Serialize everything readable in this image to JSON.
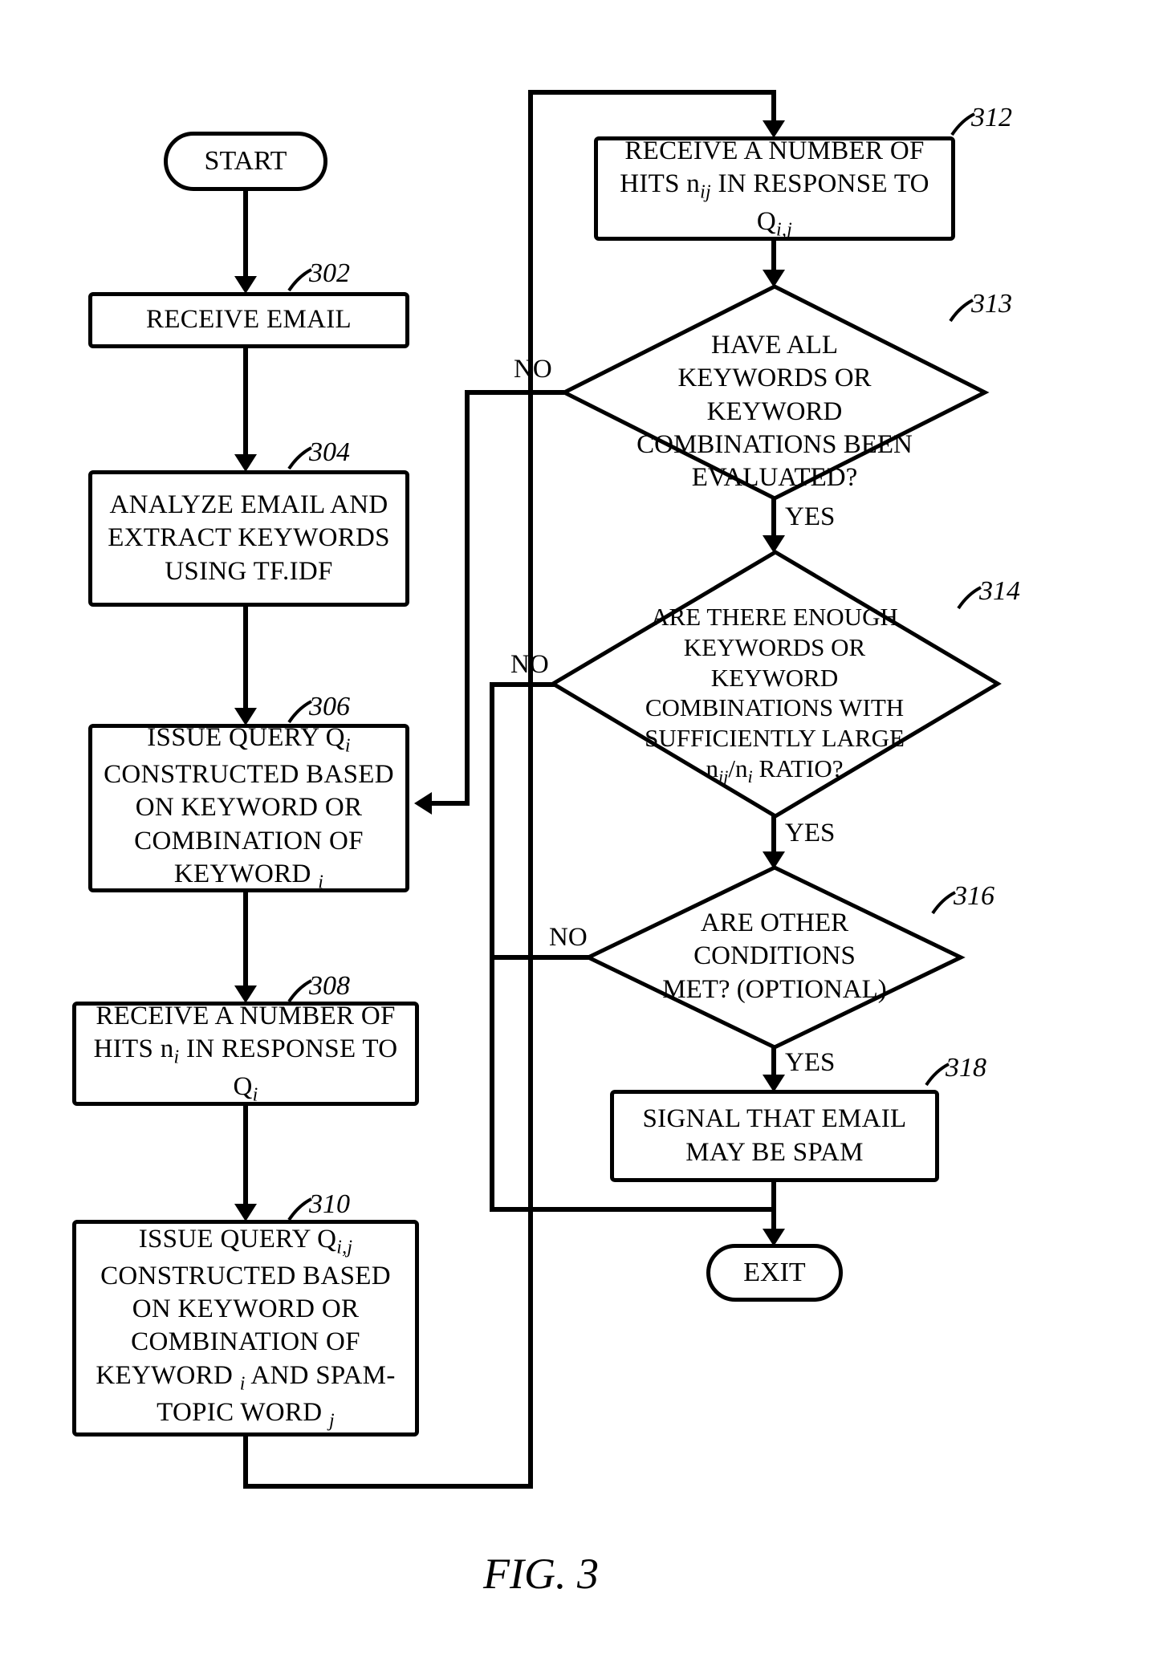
{
  "figure": "FIG. 3",
  "labels": {
    "start": "START",
    "exit": "EXIT",
    "yes": "YES",
    "no": "NO"
  },
  "steps": {
    "302": {
      "num": "302",
      "text": "RECEIVE EMAIL"
    },
    "304": {
      "num": "304",
      "text": "ANALYZE EMAIL AND EXTRACT KEYWORDS USING TF.IDF"
    },
    "306": {
      "num": "306",
      "text_pre": "ISSUE QUERY Q",
      "text_sub": "i",
      "text_post": " CONSTRUCTED BASED ON KEYWORD OR COMBINATION OF KEYWORD ",
      "text_sub2": "i"
    },
    "308": {
      "num": "308",
      "text_pre": "RECEIVE A NUMBER OF HITS n",
      "text_sub": "i",
      "text_mid": " IN RESPONSE TO Q",
      "text_sub2": "i"
    },
    "310": {
      "num": "310",
      "text_pre": "ISSUE QUERY Q",
      "text_sub": "i,j",
      "text_mid": " CONSTRUCTED BASED ON KEYWORD OR COMBINATION OF KEYWORD ",
      "text_sub2": "i",
      "text_post": " AND SPAM-TOPIC WORD ",
      "text_sub3": "j"
    },
    "312": {
      "num": "312",
      "text_pre": "RECEIVE A NUMBER OF HITS n",
      "text_sub": "ij",
      "text_mid": " IN RESPONSE TO Q",
      "text_sub2": "i,j"
    },
    "313": {
      "num": "313",
      "text": "HAVE ALL KEYWORDS OR KEYWORD COMBINATIONS BEEN EVALUATED?"
    },
    "314": {
      "num": "314",
      "text_pre": "ARE THERE ENOUGH KEYWORDS OR KEYWORD COMBINATIONS WITH SUFFICIENTLY LARGE n",
      "text_sub": "ij",
      "text_mid": "/n",
      "text_sub2": "i",
      "text_post": " RATIO?"
    },
    "316": {
      "num": "316",
      "text": "ARE OTHER CONDITIONS MET? (OPTIONAL)"
    },
    "318": {
      "num": "318",
      "text": "SIGNAL THAT EMAIL MAY BE SPAM"
    }
  }
}
